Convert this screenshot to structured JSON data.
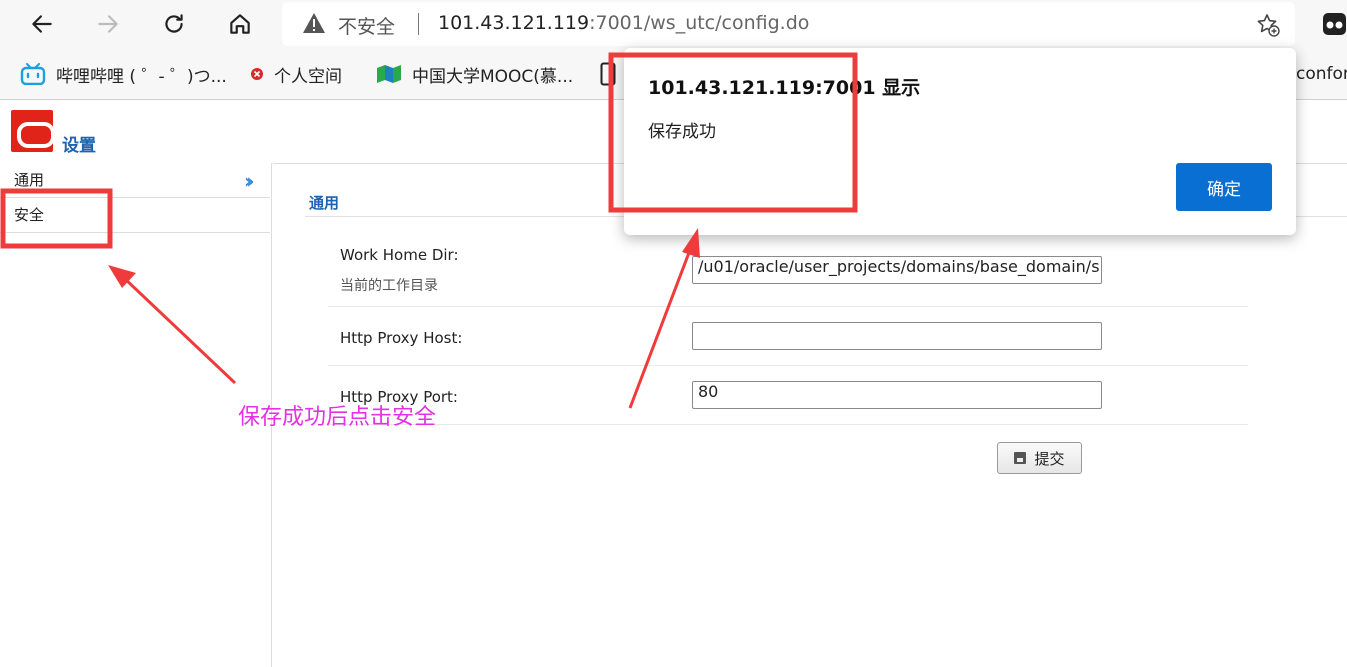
{
  "browser": {
    "insecure_label": "不安全",
    "url_host": "101.43.121.119",
    "url_rest": ":7001/ws_utc/config.do",
    "bookmarks": [
      {
        "label": "哔哩哔哩 ( ゜- ゜)つ...",
        "icon": "bilibili-icon"
      },
      {
        "label": "个人空间",
        "icon": "red-badge-icon"
      },
      {
        "label": "中国大学MOOC(慕...",
        "icon": "mooc-icon"
      },
      {
        "label": "",
        "icon": "doc-icon"
      },
      {
        "label": "confor",
        "icon": ""
      }
    ]
  },
  "page": {
    "title": "设置",
    "sidebar": {
      "items": [
        {
          "label": "通用"
        },
        {
          "label": "安全"
        }
      ]
    },
    "section_title": "通用",
    "fields": {
      "workdir_label": "Work Home Dir:",
      "workdir_sub": "当前的工作目录",
      "workdir_value": "/u01/oracle/user_projects/domains/base_domain/s",
      "proxyhost_label": "Http Proxy Host:",
      "proxyhost_value": "",
      "proxyport_label": "Http Proxy Port:",
      "proxyport_value": "80"
    },
    "submit_label": "提交"
  },
  "alert": {
    "title": "101.43.121.119:7001 显示",
    "message": "保存成功",
    "ok_label": "确定"
  },
  "annotation": {
    "text": "保存成功后点击安全",
    "color": "#e630e6",
    "box_color": "#ee3b3b"
  }
}
